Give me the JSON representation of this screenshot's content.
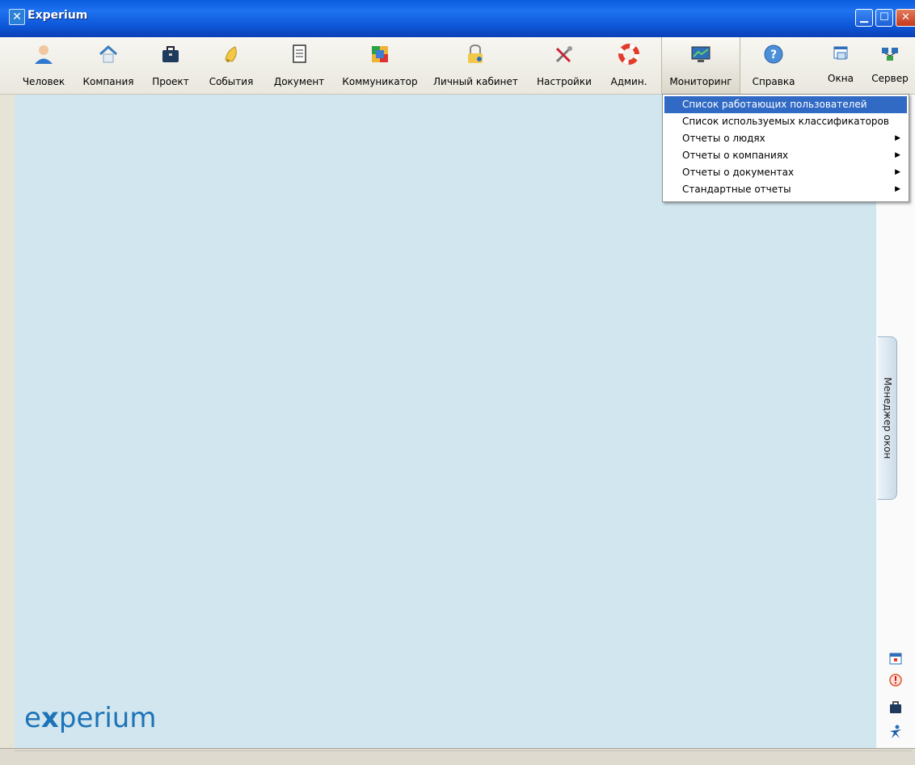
{
  "window": {
    "title": "Experium"
  },
  "toolbar": {
    "items": [
      {
        "label": "Человек",
        "icon": "person-icon"
      },
      {
        "label": "Компания",
        "icon": "house-icon"
      },
      {
        "label": "Проект",
        "icon": "briefcase-icon"
      },
      {
        "label": "События",
        "icon": "bell-icon"
      },
      {
        "label": "Документ",
        "icon": "document-icon"
      },
      {
        "label": "Коммуникатор",
        "icon": "communicator-icon"
      },
      {
        "label": "Личный кабинет",
        "icon": "lock-key-icon"
      },
      {
        "label": "Настройки",
        "icon": "tools-icon"
      },
      {
        "label": "Админ.",
        "icon": "lifebuoy-icon"
      },
      {
        "label": "Мониторинг",
        "icon": "monitor-icon"
      },
      {
        "label": "Справка",
        "icon": "help-icon"
      },
      {
        "label": "Окна",
        "icon": "windows-icon"
      },
      {
        "label": "Сервер",
        "icon": "server-icon"
      }
    ],
    "active": "Мониторинг"
  },
  "menu": {
    "items": [
      {
        "label": "Список работающих пользователей",
        "submenu": false,
        "highlighted": true
      },
      {
        "label": "Список используемых классификаторов",
        "submenu": false,
        "highlighted": false
      },
      {
        "label": "Отчеты о людях",
        "submenu": true,
        "highlighted": false
      },
      {
        "label": "Отчеты о компаниях",
        "submenu": true,
        "highlighted": false
      },
      {
        "label": "Отчеты о документах",
        "submenu": true,
        "highlighted": false
      },
      {
        "label": "Стандартные отчеты",
        "submenu": true,
        "highlighted": false
      }
    ]
  },
  "side_panel": {
    "window_manager_label": "Менеджер окон",
    "icons": [
      "calendar-icon",
      "alert-icon",
      "briefcase-icon",
      "experium-person-icon"
    ]
  },
  "logo": {
    "text_before": "e",
    "text_x": "x",
    "text_after": "perium"
  },
  "colors": {
    "workspace": "#d1e6ee",
    "menu_highlight": "#316ac5",
    "logo": "#1d73b8"
  }
}
